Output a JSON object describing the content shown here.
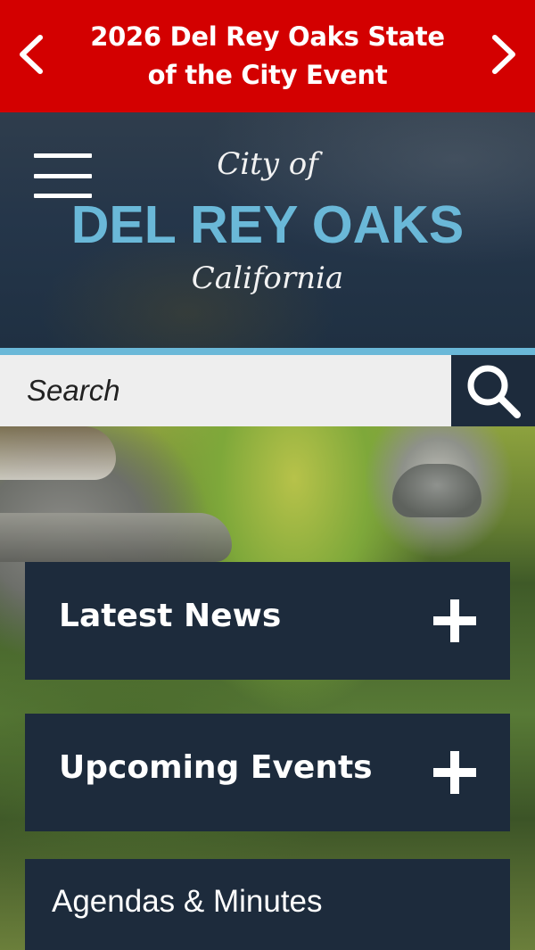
{
  "alert": {
    "message": "2026 Del Rey Oaks State of the City Event",
    "prev_icon": "chevron-left-icon",
    "next_icon": "chevron-right-icon",
    "background_color": "#d30000"
  },
  "header": {
    "logo_top": "City of",
    "logo_main": "DEL REY OAKS",
    "logo_bottom": "California",
    "menu_icon": "hamburger-menu-icon",
    "accent_color": "#6ab8d8"
  },
  "search": {
    "placeholder": "Search",
    "button_icon": "search-icon"
  },
  "panels": [
    {
      "label": "Latest News",
      "icon": "plus-icon"
    },
    {
      "label": "Upcoming Events",
      "icon": "plus-icon"
    },
    {
      "label": "Agendas & Minutes"
    }
  ],
  "colors": {
    "panel_background": "#1d2b3c"
  }
}
